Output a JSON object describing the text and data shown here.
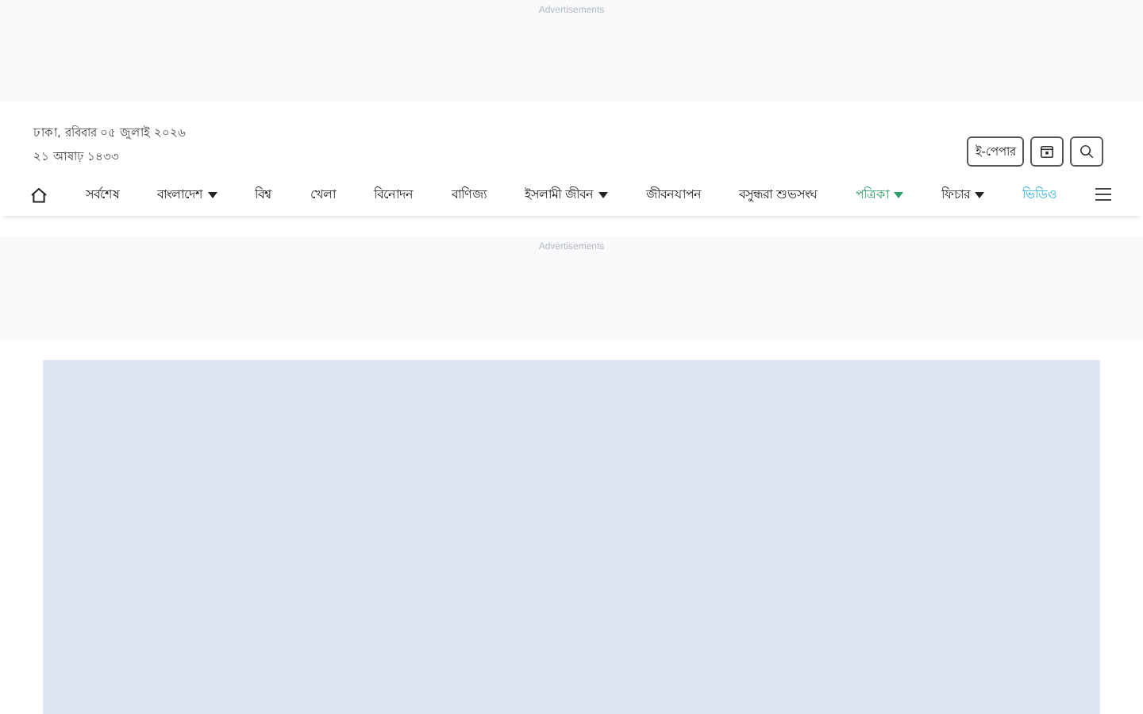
{
  "top_ad": {
    "label": "Advertisements"
  },
  "header": {
    "date_line": "ঢাকা, রবিবার ০৫ জুলাই ২০২৬",
    "hijri_line": "২১ আষাঢ় ১৪৩৩",
    "epaper_button": "ই-পেপার"
  },
  "nav": {
    "items": [
      {
        "label": "সর্বশেষ",
        "dropdown": false
      },
      {
        "label": "বাংলাদেশ",
        "dropdown": true
      },
      {
        "label": "বিশ্ব",
        "dropdown": false
      },
      {
        "label": "খেলা",
        "dropdown": false
      },
      {
        "label": "বিনোদন",
        "dropdown": false
      },
      {
        "label": "বাণিজ্য",
        "dropdown": false
      },
      {
        "label": "ইসলামী জীবন",
        "dropdown": true
      },
      {
        "label": "জীবনযাপন",
        "dropdown": false
      },
      {
        "label": "বসুন্ধরা শুভসংঘ",
        "dropdown": false
      },
      {
        "label": "পত্রিকা",
        "dropdown": true,
        "color": "#2e9e6a"
      },
      {
        "label": "ফিচার",
        "dropdown": true
      },
      {
        "label": "ভিডিও",
        "dropdown": false,
        "color": "#2bb5d8"
      }
    ]
  },
  "middle_ad": {
    "label": "Advertisements"
  }
}
